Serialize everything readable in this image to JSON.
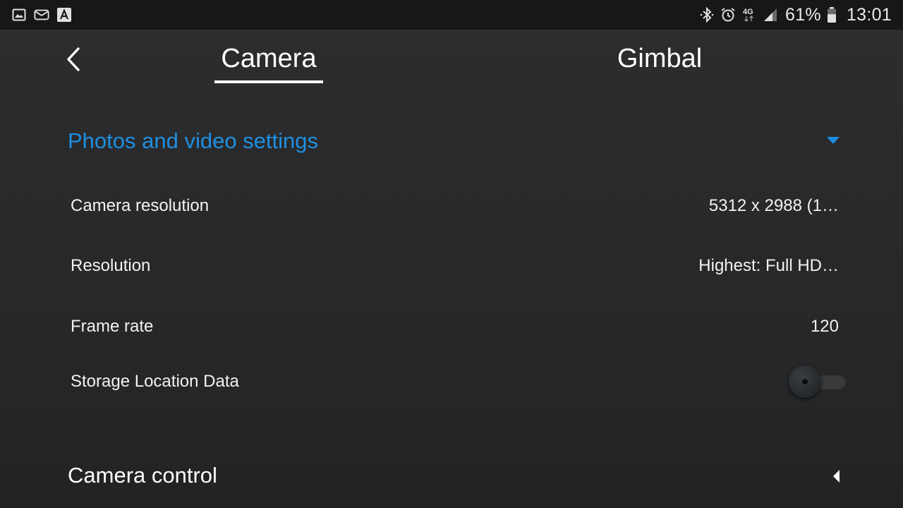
{
  "status_bar": {
    "left_icons": [
      "gallery-icon",
      "email-icon",
      "font-icon"
    ],
    "right_icons": [
      "bluetooth-icon",
      "alarm-icon",
      "network-4g-icon",
      "signal-icon"
    ],
    "network_label": "4G",
    "battery_percent": "61%",
    "battery_level": 0.61,
    "time": "13:01"
  },
  "header": {
    "back_icon": "chevron-left-icon",
    "tabs": [
      {
        "label": "Camera",
        "active": true
      },
      {
        "label": "Gimbal",
        "active": false
      }
    ]
  },
  "photo_video_section": {
    "title": "Photos and video settings",
    "expanded": true,
    "accent_color": "#1e8fe0",
    "rows": [
      {
        "label": "Camera resolution",
        "value": "5312 x 2988 (1…"
      },
      {
        "label": "Resolution",
        "value": "Highest: Full HD…"
      },
      {
        "label": "Frame rate",
        "value": "120"
      },
      {
        "label": "Storage Location Data",
        "toggle_on": false
      }
    ]
  },
  "camera_control_section": {
    "title": "Camera control",
    "expanded": false
  }
}
